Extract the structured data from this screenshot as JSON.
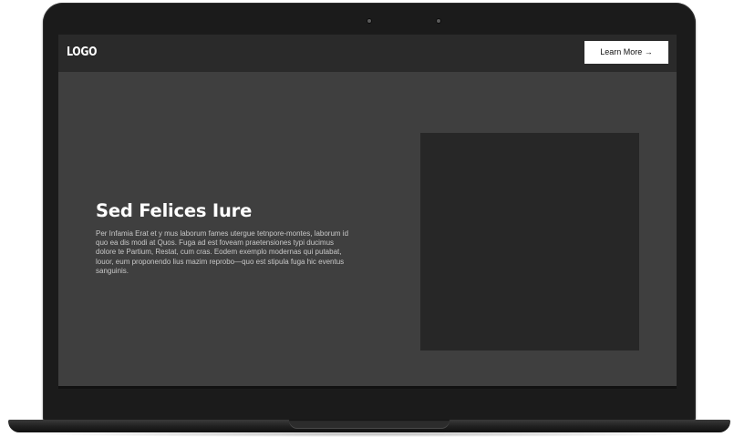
{
  "nav": {
    "logo": "LOGO",
    "cta_label": "Learn More →"
  },
  "hero": {
    "title": "Sed Felices Iure",
    "body": "Per Infamia Erat et y mus laborum fames utergue tetnpore-montes, laborum id quo ea dis modi at Quos. Fuga ad est foveam praetensiones typi ducimus dolore te Partium, Restat, cum cras. Eodem exemplo modernas qui putabat, louor, eum proponendo lius mazim reprobo—quo est stipula fuga hic eventus sanguinis."
  },
  "colors": {
    "page_background": "#3f3f3f",
    "nav_background": "#2a2a2a",
    "cta_background": "#ffffff",
    "image_placeholder": "#272727"
  }
}
